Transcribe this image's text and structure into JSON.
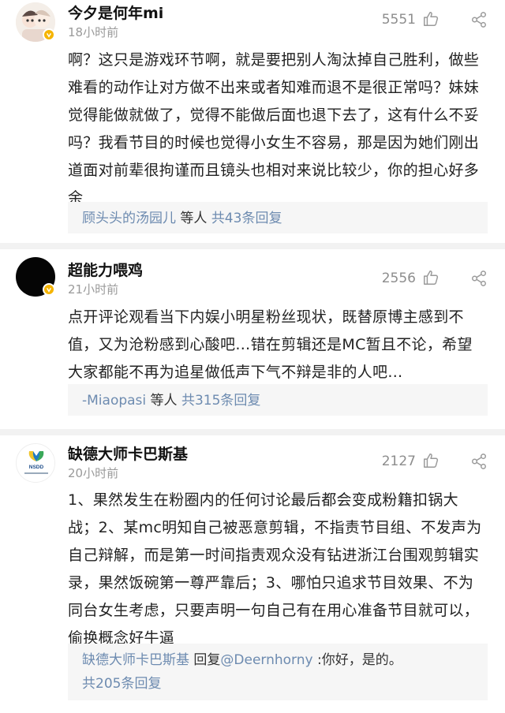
{
  "comments": [
    {
      "username": "今夕是何年mi",
      "time": "18小时前",
      "likes": "5551",
      "avatar": "anime-avatar",
      "text": "啊？这只是游戏环节啊，就是要把别人淘汰掉自己胜利，做些难看的动作让对方做不出来或者知难而退不是很正常吗？妹妹觉得能做就做了，觉得不能做后面也退下去了，这有什么不妥吗？我看节目的时候也觉得小女生不容易，那是因为她们刚出道面对前辈很拘谨而且镜头也相对来说比较少，你的担心好多余",
      "reply_user": "顾头头的汤园儿",
      "reply_mid": "等人",
      "reply_count": "共43条回复"
    },
    {
      "username": "超能力喂鸡",
      "time": "21小时前",
      "likes": "2556",
      "avatar": "black-avatar",
      "text": "点开评论观看当下内娱小明星粉丝现状，既替原博主感到不值，又为沧粉感到心酸吧…错在剪辑还是MC暂且不论，希望大家都能不再为追星做低声下气不辩是非的人吧…",
      "reply_user": "-Miaopasi",
      "reply_mid": "等人",
      "reply_count": "共315条回复"
    },
    {
      "username": "缺德大师卡巴斯基",
      "time": "20小时前",
      "likes": "2127",
      "avatar": "logo-avatar",
      "avatar_logo_text": "NSDD",
      "text": "1、果然发生在粉圈内的任何讨论最后都会变成粉籍扣锅大战；2、某mc明知自己被恶意剪辑，不指责节目组、不发声为自己辩解，而是第一时间指责观众没有钻进浙江台围观剪辑实录，果然饭碗第一尊严靠后；3、哪怕只追求节目效果、不为同台女生考虑，只要声明一句自己有在用心准备节目就可以，偷换概念好牛逼",
      "reply_user": "缺德大师卡巴斯基",
      "reply_verb": "回复",
      "reply_target": "@Deernhorny",
      "reply_text": ":你好，是的。",
      "reply_count": "共205条回复"
    }
  ],
  "colors": {
    "link": "#6d8bb0",
    "badge": "#f5b400",
    "divider": "#f2f2f2"
  }
}
